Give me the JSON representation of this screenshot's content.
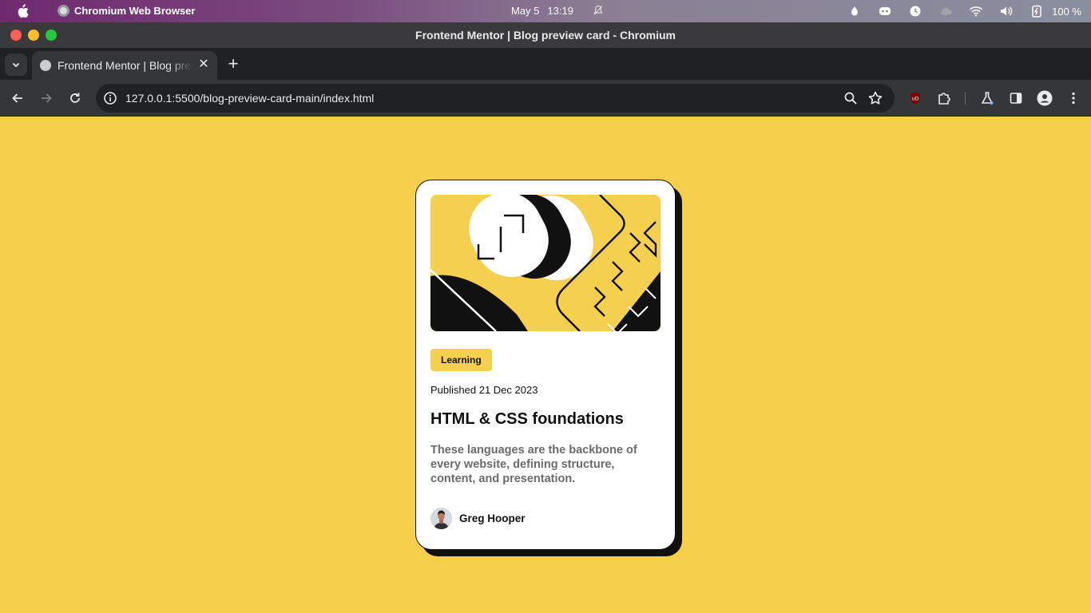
{
  "menubar": {
    "app_name": "Chromium Web Browser",
    "date": "May 5",
    "time": "13:19",
    "battery_percent": "100 %",
    "tray_icons": [
      "drop-icon",
      "discord-icon",
      "clock-icon",
      "cloud-icon",
      "wifi-icon",
      "volume-icon",
      "battery-icon"
    ]
  },
  "window": {
    "title": "Frontend Mentor | Blog preview card - Chromium",
    "traffic_lights": {
      "close": "#ff5f57",
      "minimize": "#febc2e",
      "maximize": "#28c840"
    }
  },
  "tabs": [
    {
      "label": "Frontend Mentor | Blog preview card",
      "close": "✕"
    }
  ],
  "toolbar": {
    "url": "127.0.0.1:5500/blog-preview-card-main/index.html",
    "new_tab": "+"
  },
  "card": {
    "tag": "Learning",
    "published": "Published 21 Dec 2023",
    "title": "HTML & CSS foundations",
    "description": "These languages are the backbone of every website, defining structure, content, and presentation.",
    "author": "Greg Hooper"
  },
  "colors": {
    "page_background": "#f5ce4b",
    "card_background": "#ffffff",
    "card_border": "#111111",
    "tag_background": "#f4d04e",
    "description_text": "#6b6b6b"
  }
}
